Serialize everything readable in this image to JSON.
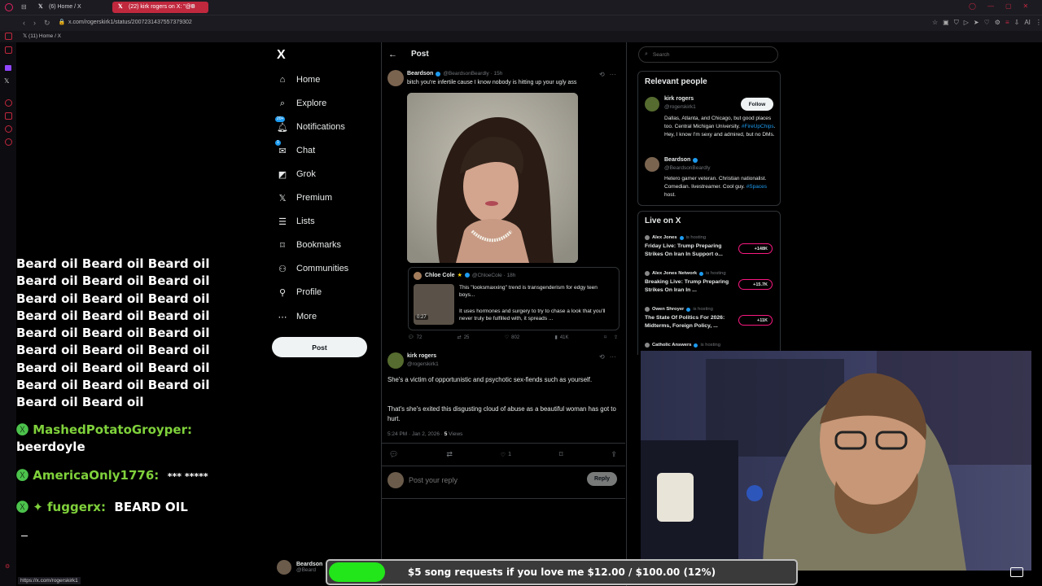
{
  "browser": {
    "tabs": [
      {
        "title": "(6) Home / X",
        "active": false
      },
      {
        "title": "(22) kirk rogers on X: \"@B",
        "active": true
      }
    ],
    "url": "x.com/rogerskirk1/status/2007231437557379302",
    "bookmark_tab": "(11) Home / X",
    "status_url": "https://x.com/rogerskirk1"
  },
  "chat_overlay": {
    "spam_lines": [
      "Beard oil Beard oil Beard oil",
      "Beard oil Beard oil Beard oil",
      "Beard oil Beard oil Beard oil",
      "Beard oil Beard oil Beard oil",
      "Beard oil Beard oil Beard oil",
      "Beard oil Beard oil Beard oil",
      "Beard oil Beard oil Beard oil",
      "Beard oil Beard oil Beard oil",
      "Beard oil Beard oil"
    ],
    "messages": [
      {
        "user": "MashedPotatoGroyper:",
        "text": "beerdoyle",
        "user_color": "#7fd13b"
      },
      {
        "user": "AmericaOnly1776:",
        "text": "*** *****",
        "user_color": "#7fd13b"
      },
      {
        "user": "fuggerx:",
        "text": "BEARD OIL",
        "user_color": "#7fd13b"
      }
    ]
  },
  "nav": {
    "logo": "X",
    "items": [
      {
        "label": "Home",
        "icon": "home-icon"
      },
      {
        "label": "Explore",
        "icon": "search-icon"
      },
      {
        "label": "Notifications",
        "icon": "bell-icon",
        "badge": "20+"
      },
      {
        "label": "Chat",
        "icon": "chat-icon",
        "badge": "1"
      },
      {
        "label": "Grok",
        "icon": "grok-icon"
      },
      {
        "label": "Premium",
        "icon": "x-premium-icon"
      },
      {
        "label": "Lists",
        "icon": "list-icon"
      },
      {
        "label": "Bookmarks",
        "icon": "bookmark-icon"
      },
      {
        "label": "Communities",
        "icon": "communities-icon"
      },
      {
        "label": "Profile",
        "icon": "profile-icon"
      },
      {
        "label": "More",
        "icon": "more-icon"
      }
    ],
    "post_button": "Post",
    "account_name": "Beardson",
    "account_handle": "@Beard"
  },
  "header": {
    "back": "←",
    "title": "Post"
  },
  "parent_post": {
    "name": "Beardson",
    "handle": "@BeardsonBeardly · 15h",
    "text": "bitch you're infertile cause I know nobody is hitting up your ugly ass",
    "quote": {
      "name": "Chloe Cole",
      "handle": "@ChloeCole · 18h",
      "text1": "This \"looksmaxxing\" trend is transgenderism for edgy teen boys...",
      "text2": "It uses hormones and surgery to try to chase a look that you'll never truly be fulfilled with, it spreads ...",
      "video_time": "0:27"
    },
    "stats": {
      "replies": "72",
      "reposts": "25",
      "likes": "802",
      "views": "41K"
    }
  },
  "main_post": {
    "name": "kirk rogers",
    "handle": "@rogerskirk1",
    "para1": "She's a victim of opportunistic and psychotic sex-fiends such as yourself.",
    "para2": "That's she's exited this disgusting cloud of abuse as a beautiful woman has got to hurt.",
    "meta": "5:24 PM · Jan 2, 2026 · ",
    "views_count": "5",
    "views_label": " Views",
    "likes": "1"
  },
  "reply_box": {
    "placeholder": "Post your reply",
    "button": "Reply"
  },
  "search": {
    "placeholder": "Search"
  },
  "relevant_people": {
    "title": "Relevant people",
    "people": [
      {
        "name": "kirk rogers",
        "handle": "@rogerskirk1",
        "bio_pre": "Dallas, Atlanta, and Chicago, but good places too. Central Michigan University. ",
        "bio_tag": "#FireUpChips",
        "bio_post": ". Hey, I know I'm sexy and admired, but no DMs.",
        "follow": "Follow"
      },
      {
        "name": "Beardson",
        "handle": "@BeardsonBeardly",
        "bio_pre": "Hetero gamer veteran. Christian nationalist. Comedian. livestreamer. Cool guy. ",
        "bio_tag": "#Spaces",
        "bio_post": " host."
      }
    ]
  },
  "live": {
    "title": "Live on X",
    "items": [
      {
        "host": "Alex Jones",
        "status": "is hosting",
        "title": "Friday Live: Trump Preparing Strikes On Iran In Support o...",
        "count": "+148K"
      },
      {
        "host": "Alex Jones Network",
        "status": "is hosting",
        "title": "Breaking Live: Trump Preparing Strikes On Iran In ...",
        "count": "+15.7K"
      },
      {
        "host": "Owen Shroyer",
        "status": "is hosting",
        "title": "The State Of Politics For 2026: Midterms, Foreign Policy, ...",
        "count": "+11K"
      },
      {
        "host": "Catholic Answers",
        "status": "is hosting",
        "title": "",
        "count": ""
      }
    ]
  },
  "donation_bar": {
    "text": "$5 song requests if you love me $12.00 / $100.00 (12%)",
    "progress": 0.12,
    "color": "#22e51a"
  },
  "colors": {
    "accent": "#1d9bf0",
    "bg": "#000000",
    "border": "#2f3336",
    "live": "#f91880"
  }
}
